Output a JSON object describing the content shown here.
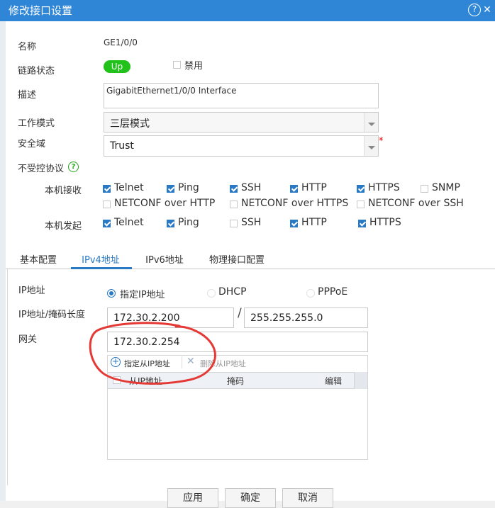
{
  "window": {
    "title": "修改接口设置",
    "help_icon": "question-circle-icon",
    "close_icon": "close-icon"
  },
  "fields": {
    "name_label": "名称",
    "name_value": "GE1/0/0",
    "link_label": "链路状态",
    "link_status": "Up",
    "disable_label": "禁用",
    "desc_label": "描述",
    "desc_value": "GigabitEthernet1/0/0 Interface",
    "mode_label": "工作模式",
    "mode_value": "三层模式",
    "zone_label": "安全域",
    "zone_value": "Trust",
    "required_mark": "*",
    "unctrl_label": "不受控协议"
  },
  "protocols": {
    "receive_label": "本机接收",
    "receive": [
      {
        "label": "Telnet",
        "checked": true
      },
      {
        "label": "Ping",
        "checked": true
      },
      {
        "label": "SSH",
        "checked": true
      },
      {
        "label": "HTTP",
        "checked": true
      },
      {
        "label": "HTTPS",
        "checked": true
      },
      {
        "label": "SNMP",
        "checked": false
      },
      {
        "label": "NETCONF over HTTP",
        "checked": false
      },
      {
        "label": "NETCONF over HTTPS",
        "checked": false
      },
      {
        "label": "NETCONF over SSH",
        "checked": false
      }
    ],
    "send_label": "本机发起",
    "send": [
      {
        "label": "Telnet",
        "checked": true
      },
      {
        "label": "Ping",
        "checked": true
      },
      {
        "label": "SSH",
        "checked": false
      },
      {
        "label": "HTTP",
        "checked": true
      },
      {
        "label": "HTTPS",
        "checked": true
      }
    ]
  },
  "tabs": [
    {
      "label": "基本配置",
      "active": false
    },
    {
      "label": "IPv4地址",
      "active": true
    },
    {
      "label": "IPv6地址",
      "active": false
    },
    {
      "label": "物理接口配置",
      "active": false
    }
  ],
  "ipv4": {
    "ip_label": "IP地址",
    "modes": [
      {
        "label": "指定IP地址",
        "selected": true
      },
      {
        "label": "DHCP",
        "selected": false
      },
      {
        "label": "PPPoE",
        "selected": false
      }
    ],
    "ipmask_label": "IP地址/掩码长度",
    "ip_value": "172.30.2.200",
    "slash": "/",
    "mask_value": "255.255.255.0",
    "gateway_label": "网关",
    "gateway_value": "172.30.2.254",
    "add_secondary": "指定从IP地址",
    "delete_secondary": "删除从IP地址",
    "columns": [
      "从IP地址",
      "掩码",
      "编辑"
    ]
  },
  "buttons": {
    "apply": "应用",
    "ok": "确定",
    "cancel": "取消"
  },
  "colors": {
    "titlebar": "#2f86d6",
    "accent": "#2a79c4",
    "status_up": "#23c11c",
    "annotation": "#e53935"
  }
}
